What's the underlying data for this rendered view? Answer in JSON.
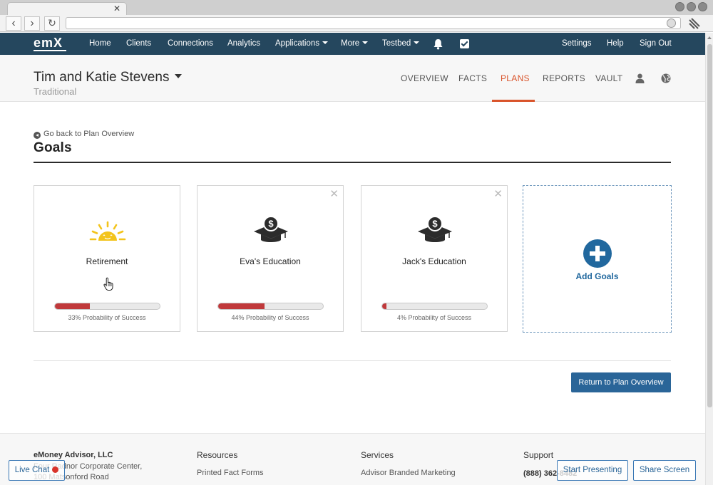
{
  "nav": {
    "logo": "emX",
    "items": [
      "Home",
      "Clients",
      "Connections",
      "Analytics",
      "Applications",
      "More",
      "Testbed"
    ],
    "right_items": [
      "Settings",
      "Help",
      "Sign Out"
    ]
  },
  "client": {
    "name": "Tim and Katie Stevens",
    "type": "Traditional",
    "tabs": [
      "OVERVIEW",
      "FACTS",
      "PLANS",
      "REPORTS",
      "VAULT"
    ],
    "active_tab": "PLANS"
  },
  "page": {
    "back_link": "Go back to Plan Overview",
    "title": "Goals"
  },
  "goals": [
    {
      "name": "Retirement",
      "icon": "sun-icon",
      "probability_percent": 33,
      "probability_label": "33% Probability of Success",
      "removable": false
    },
    {
      "name": "Eva's Education",
      "icon": "graduation-cap-icon",
      "probability_percent": 44,
      "probability_label": "44% Probability of Success",
      "removable": true
    },
    {
      "name": "Jack's Education",
      "icon": "graduation-cap-icon",
      "probability_percent": 4,
      "probability_label": "4% Probability of Success",
      "removable": true
    }
  ],
  "add_goal": {
    "label": "Add Goals"
  },
  "actions": {
    "return_label": "Return to Plan Overview"
  },
  "footer": {
    "company": "eMoney Advisor, LLC",
    "address_1": "Four Radnor Corporate Center,",
    "address_2": "100 Matsonford Road",
    "resources_heading": "Resources",
    "resources_item": "Printed Fact Forms",
    "services_heading": "Services",
    "services_item": "Advisor Branded Marketing",
    "support_heading": "Support",
    "support_phone": "(888) 362-8482"
  },
  "overlay": {
    "live_chat": "Live Chat",
    "start_presenting": "Start Presenting",
    "share_screen": "Share Screen"
  },
  "colors": {
    "nav_bg": "#25475e",
    "accent_active": "#d9542b",
    "progress_fill": "#c0393b",
    "primary_button": "#2a6598",
    "add_goal_blue": "#21689e",
    "sun_yellow": "#f3c41c"
  }
}
